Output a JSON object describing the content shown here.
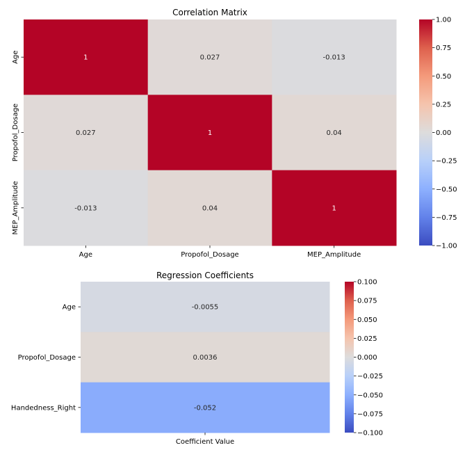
{
  "chart_data": [
    {
      "type": "heatmap",
      "title": "Correlation Matrix",
      "xlabel": "",
      "ylabel": "",
      "x_categories": [
        "Age",
        "Propofol_Dosage",
        "MEP_Amplitude"
      ],
      "y_categories": [
        "Age",
        "Propofol_Dosage",
        "MEP_Amplitude"
      ],
      "values": [
        [
          1,
          0.027,
          -0.013
        ],
        [
          0.027,
          1,
          0.04
        ],
        [
          -0.013,
          0.04,
          1
        ]
      ],
      "annotations": [
        [
          "1",
          "0.027",
          "-0.013"
        ],
        [
          "0.027",
          "1",
          "0.04"
        ],
        [
          "-0.013",
          "0.04",
          "1"
        ]
      ],
      "colormap": "coolwarm",
      "vmin": -1.0,
      "vmax": 1.0,
      "colorbar_ticks": [
        "1.00",
        "0.75",
        "0.50",
        "0.25",
        "0.00",
        "−0.25",
        "−0.50",
        "−0.75",
        "−1.00"
      ],
      "colorbar_tick_values": [
        1.0,
        0.75,
        0.5,
        0.25,
        0.0,
        -0.25,
        -0.5,
        -0.75,
        -1.0
      ],
      "colorbar_placement": "right"
    },
    {
      "type": "heatmap",
      "title": "Regression Coefficients",
      "xlabel": "",
      "ylabel": "",
      "x_categories": [
        "Coefficient Value"
      ],
      "y_categories": [
        "Age",
        "Propofol_Dosage",
        "Handedness_Right"
      ],
      "values": [
        [
          -0.0055
        ],
        [
          0.0036
        ],
        [
          -0.052
        ]
      ],
      "annotations": [
        [
          "-0.0055"
        ],
        [
          "0.0036"
        ],
        [
          "-0.052"
        ]
      ],
      "colormap": "coolwarm",
      "vmin": -0.1,
      "vmax": 0.1,
      "colorbar_ticks": [
        "0.100",
        "0.075",
        "0.050",
        "0.025",
        "0.000",
        "−0.025",
        "−0.050",
        "−0.075",
        "−0.100"
      ],
      "colorbar_tick_values": [
        0.1,
        0.075,
        0.05,
        0.025,
        0.0,
        -0.025,
        -0.05,
        -0.075,
        -0.1
      ],
      "colorbar_placement": "right"
    }
  ]
}
